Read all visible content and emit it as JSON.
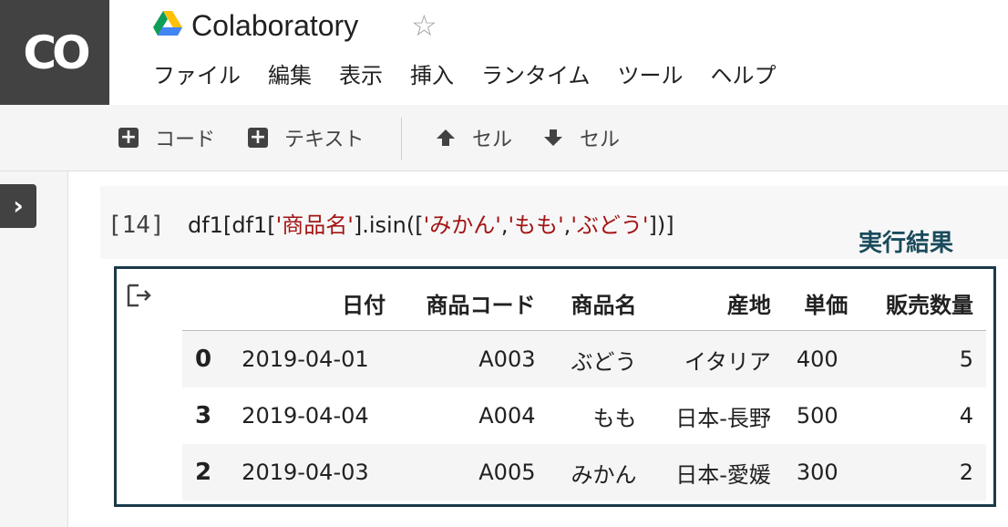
{
  "app": {
    "logo_text": "CO",
    "title": "Colaboratory",
    "star_glyph": "☆",
    "drive_icon": "google-drive-icon"
  },
  "menu": [
    "ファイル",
    "編集",
    "表示",
    "挿入",
    "ランタイム",
    "ツール",
    "ヘルプ"
  ],
  "toolbar": {
    "add_code_label": "コード",
    "add_text_label": "テキスト",
    "cell_up_label": "セル",
    "cell_down_label": "セル"
  },
  "sidebar": {
    "toggle_glyph": "›"
  },
  "cell": {
    "execution_count": "[14]",
    "code_parts": [
      "df1[df1[",
      "'商品名'",
      "].isin([",
      "'みかん'",
      ",",
      "'もも'",
      ",",
      "'ぶどう'",
      "])]"
    ]
  },
  "annotation": {
    "label": "実行結果",
    "color": "#1a4b5c"
  },
  "table": {
    "columns": [
      "日付",
      "商品コード",
      "商品名",
      "産地",
      "単価",
      "販売数量"
    ],
    "rows": [
      {
        "index": "0",
        "cells": [
          "2019-04-01",
          "A003",
          "ぶどう",
          "イタリア",
          "400",
          "5"
        ]
      },
      {
        "index": "3",
        "cells": [
          "2019-04-04",
          "A004",
          "もも",
          "日本-長野",
          "500",
          "4"
        ]
      },
      {
        "index": "2",
        "cells": [
          "2019-04-03",
          "A005",
          "みかん",
          "日本-愛媛",
          "300",
          "2"
        ]
      }
    ]
  },
  "colors": {
    "logo_bg": "#424242",
    "string_literal": "#a31515",
    "frame_border": "#1a3a4a"
  }
}
